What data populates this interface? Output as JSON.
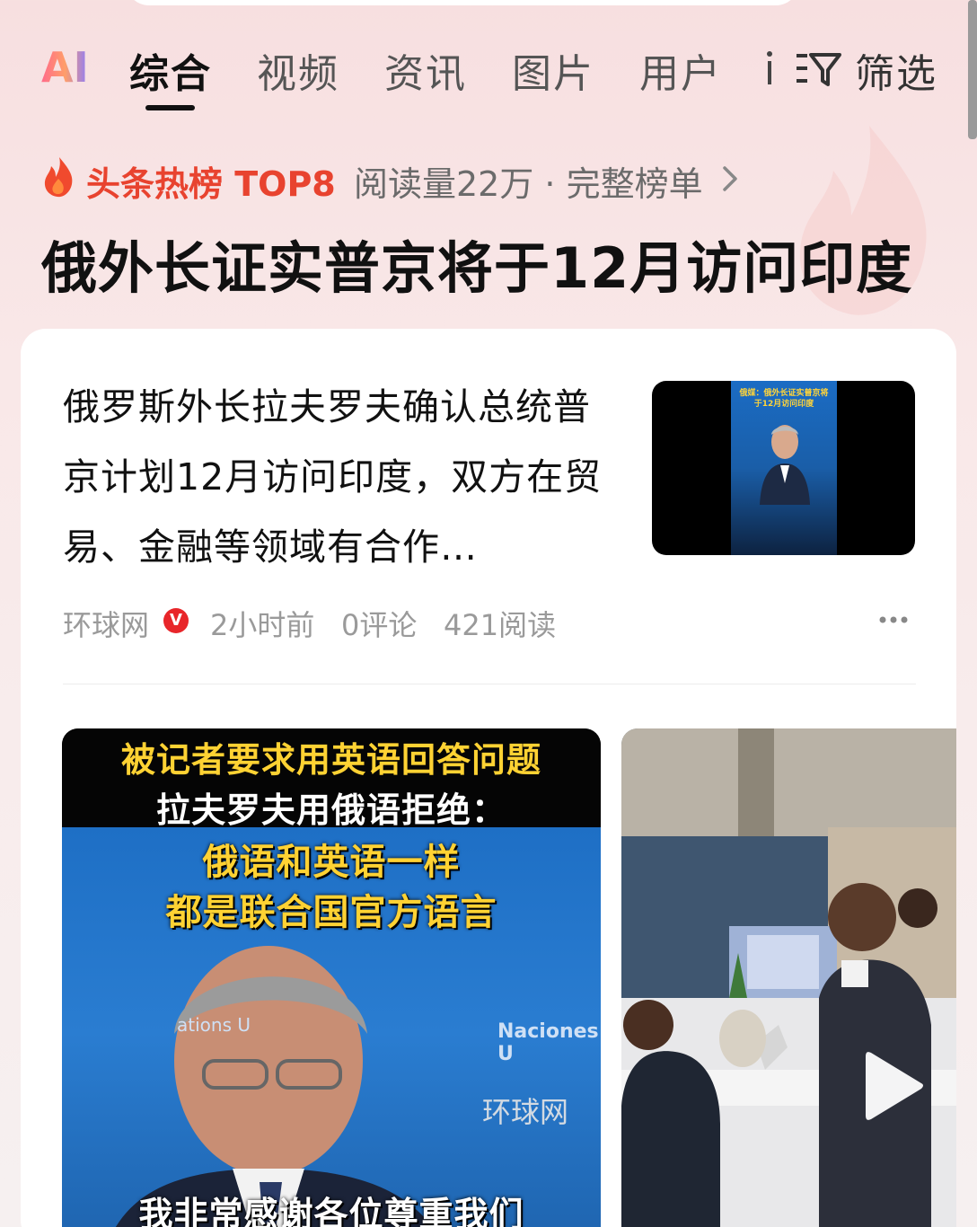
{
  "tabs": {
    "ai_label": "AI",
    "items": [
      "综合",
      "视频",
      "资讯",
      "图片",
      "用户"
    ],
    "active_index": 0,
    "filter_label": "筛选"
  },
  "hot_list": {
    "label": "头条热榜 TOP8",
    "meta": "阅读量22万 · 完整榜单",
    "headline": "俄外长证实普京将于12月访问印度"
  },
  "article": {
    "text": "俄罗斯外长拉夫罗夫确认总统普京计划12月访问印度，双方在贸易、金融等领域有合作…",
    "source": "环球网",
    "verified_mark": "V",
    "time": "2小时前",
    "comments": "0评论",
    "reads": "421阅读",
    "thumb_caption": "俄媒：俄外长证实普京将于12月访问印度"
  },
  "video_left": {
    "caption_1": "被记者要求用英语回答问题",
    "caption_2": "拉夫罗夫用俄语拒绝：",
    "caption_3": "俄语和英语一样",
    "caption_4": "都是联合国官方语言",
    "caption_5": "我非常感谢各位尊重我们",
    "watermark": "环球网",
    "bg_text_left": "ations U",
    "bg_text_right": "Naciones U"
  },
  "colors": {
    "accent_red": "#e8432f",
    "badge_red": "#e8262a",
    "caption_yellow": "#ffd233"
  },
  "icons": [
    "ai-logo",
    "more-vert-icon",
    "filter-icon",
    "fire-icon",
    "chevron-right-icon",
    "verified-badge",
    "more-horizontal-icon",
    "play-icon"
  ]
}
